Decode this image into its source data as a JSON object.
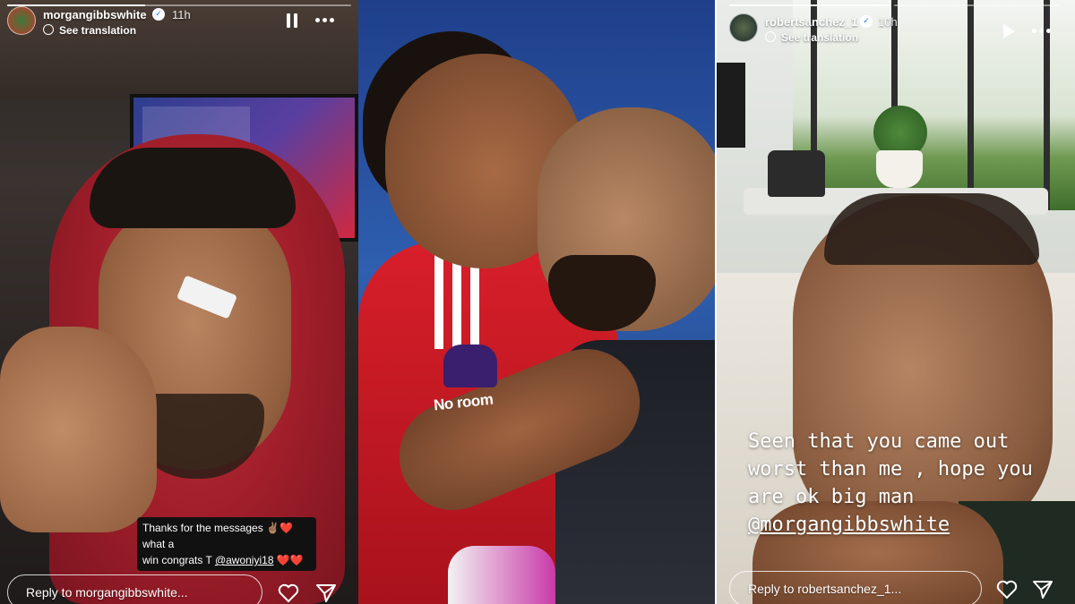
{
  "stories": [
    {
      "username": "morgangibbswhite",
      "verified": true,
      "time": "11h",
      "translate_label": "See translation",
      "control": "pause",
      "caption_line1": "Thanks for the messages ✌🏽❤️ what a",
      "caption_line2_prefix": "win congrats T ",
      "caption_mention": "@awoniyi18",
      "caption_suffix": " ❤️❤️",
      "reply_placeholder": "Reply to morgangibbswhite..."
    },
    {
      "sponsor_text": "No room"
    },
    {
      "username": "robertsanchez_1",
      "verified": true,
      "time": "10h",
      "translate_label": "See translation",
      "control": "play",
      "caption_line1": "Seen that you came out",
      "caption_line2": "worst than me , hope you",
      "caption_line3": "are ok big man",
      "caption_mention": "@morgangibbswhite",
      "reply_placeholder": "Reply to robertsanchez_1..."
    }
  ],
  "icons": {
    "verified": "verified-badge-icon",
    "globe": "globe-icon",
    "pause": "pause-icon",
    "play": "play-icon",
    "more": "more-icon",
    "like": "heart-icon",
    "share": "send-icon"
  },
  "colors": {
    "verified_blue": "#1877f2",
    "forest_red": "#d81f2a"
  }
}
